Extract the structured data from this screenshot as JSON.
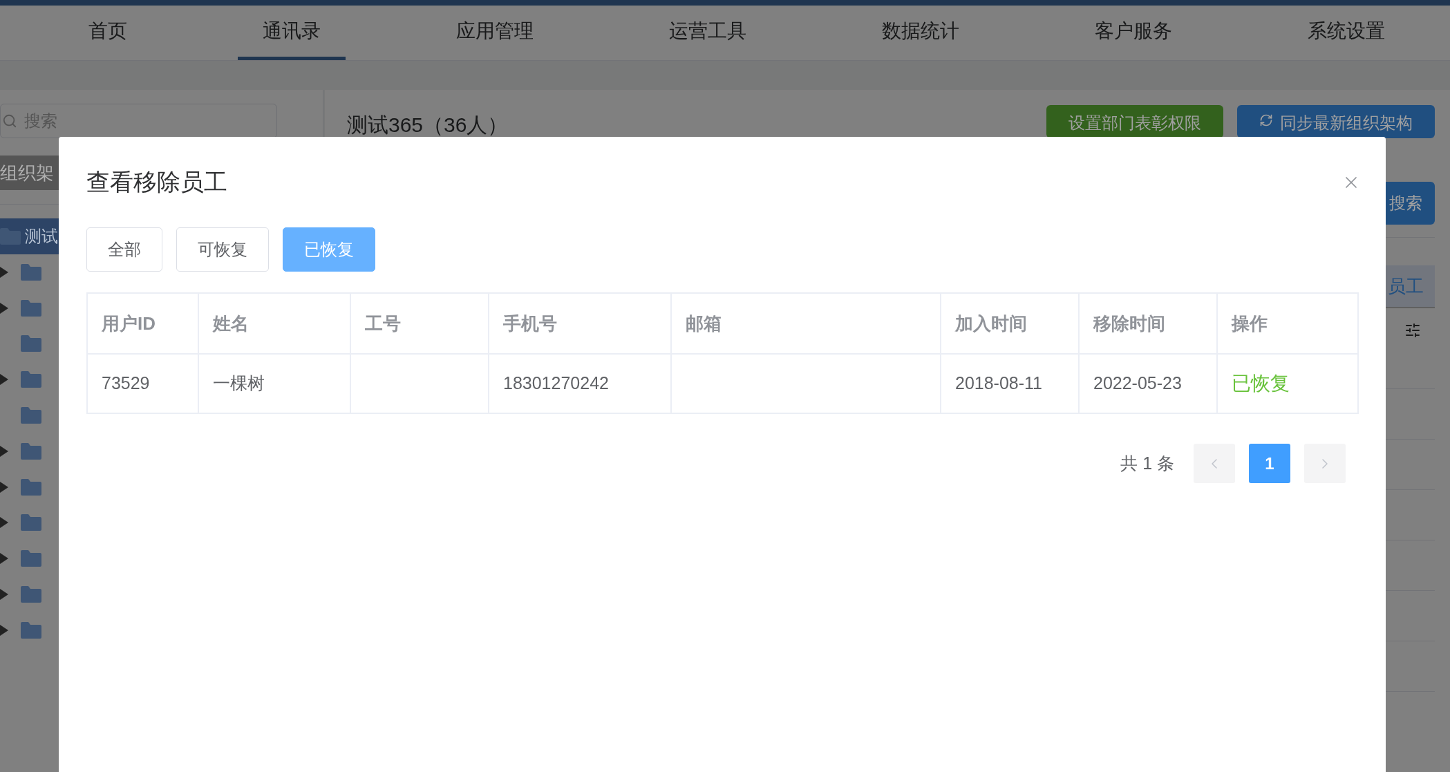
{
  "nav": {
    "items": [
      {
        "label": "首页",
        "selected": false
      },
      {
        "label": "通讯录",
        "selected": true
      },
      {
        "label": "应用管理",
        "selected": false
      },
      {
        "label": "运营工具",
        "selected": false
      },
      {
        "label": "数据统计",
        "selected": false
      },
      {
        "label": "客户服务",
        "selected": false
      },
      {
        "label": "系统设置",
        "selected": false
      }
    ]
  },
  "sidebar": {
    "search": {
      "placeholder": "搜索"
    },
    "tab": "组织架",
    "tree": [
      {
        "label": "测试",
        "selected": true,
        "children": [
          {
            "expandable": true
          },
          {
            "expandable": true
          },
          {
            "expandable": false
          },
          {
            "expandable": true
          },
          {
            "expandable": false
          },
          {
            "expandable": true
          },
          {
            "expandable": true
          },
          {
            "expandable": true
          },
          {
            "expandable": true
          },
          {
            "expandable": true
          },
          {
            "expandable": true
          }
        ]
      }
    ]
  },
  "main": {
    "title": "测试365（36人）",
    "buttons": [
      {
        "label": "设置部门表彰权限",
        "kind": "plain"
      },
      {
        "label": "同步最新组织架构",
        "kind": "sync"
      }
    ],
    "search_button": "搜索",
    "tab": "员工"
  },
  "dialog": {
    "title": "查看移除员工",
    "filters": [
      {
        "label": "全部",
        "selected": false
      },
      {
        "label": "可恢复",
        "selected": false
      },
      {
        "label": "已恢复",
        "selected": true
      }
    ],
    "table": {
      "columns": [
        "用户ID",
        "姓名",
        "工号",
        "手机号",
        "邮箱",
        "加入时间",
        "移除时间",
        "操作"
      ],
      "rows": [
        {
          "cells": [
            "73529",
            "一棵树",
            null,
            "18301270242",
            null,
            "2018-08-11",
            "2022-05-23"
          ],
          "action": "已恢复"
        }
      ]
    },
    "pagination": {
      "total": "共 1 条",
      "prev_disabled": true,
      "next_disabled": true,
      "pages": [
        {
          "label": "1",
          "selected": true
        }
      ]
    }
  }
}
